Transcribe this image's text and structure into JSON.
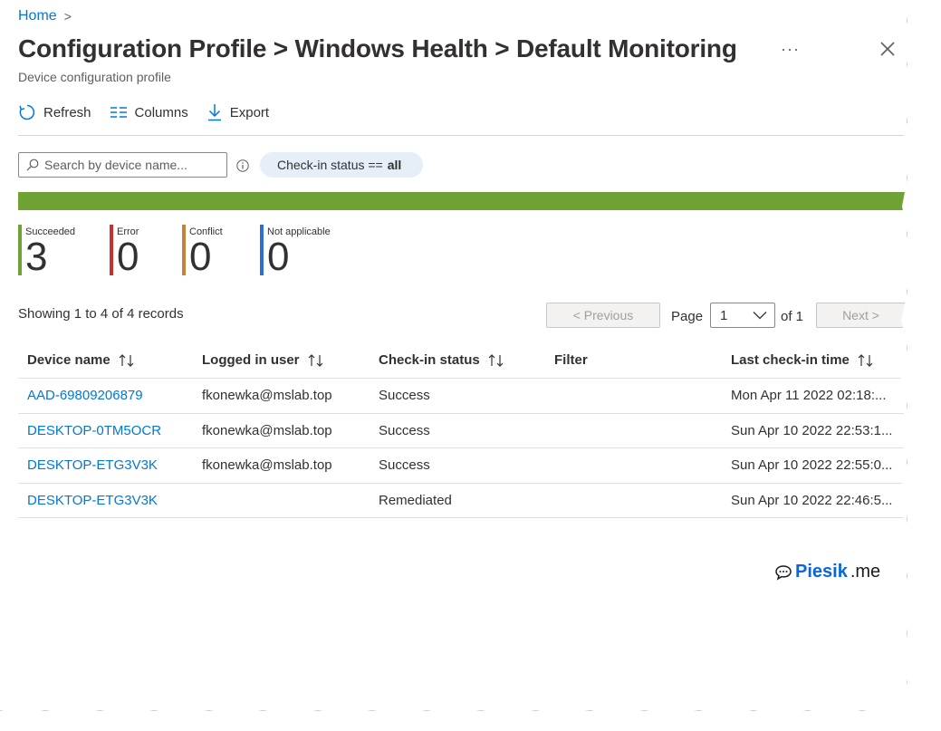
{
  "breadcrumb": {
    "home": "Home",
    "separator": ">"
  },
  "header": {
    "title": "Configuration Profile > Windows Health > Default Monitoring",
    "subtitle": "Device configuration profile",
    "more_glyph": "···",
    "close_icon": "close-icon"
  },
  "toolbar": {
    "refresh_label": "Refresh",
    "columns_label": "Columns",
    "export_label": "Export"
  },
  "filters": {
    "search_placeholder": "Search by device name...",
    "pill_prefix": "Check-in status ==",
    "pill_value": "all"
  },
  "progress": {
    "succeeded_fraction": 1.0,
    "color": "#6ea232"
  },
  "stats": [
    {
      "label": "Succeeded",
      "value": "3",
      "color": "#6ea232"
    },
    {
      "label": "Error",
      "value": "0",
      "color": "#c2342d"
    },
    {
      "label": "Conflict",
      "value": "0",
      "color": "#c8813a"
    },
    {
      "label": "Not applicable",
      "value": "0",
      "color": "#2f6fd1"
    }
  ],
  "pagination": {
    "showing": "Showing 1 to 4 of 4 records",
    "previous": "< Previous",
    "page_label": "Page",
    "page_value": "1",
    "of_label": "of 1",
    "next": "Next >"
  },
  "table": {
    "columns": [
      "Device name",
      "Logged in user",
      "Check-in status",
      "Filter",
      "Last check-in time"
    ],
    "sortable": [
      true,
      true,
      true,
      false,
      true
    ],
    "rows": [
      [
        "AAD-69809206879",
        "fkonewka@mslab.top",
        "Success",
        "",
        "Mon Apr 11 2022 02:18:..."
      ],
      [
        "DESKTOP-0TM5OCR",
        "fkonewka@mslab.top",
        "Success",
        "",
        "Sun Apr 10 2022 22:53:1..."
      ],
      [
        "DESKTOP-ETG3V3K",
        "fkonewka@mslab.top",
        "Success",
        "",
        "Sun Apr 10 2022 22:55:0..."
      ],
      [
        "DESKTOP-ETG3V3K",
        "",
        "Remediated",
        "",
        "Sun Apr 10 2022 22:46:5..."
      ]
    ]
  },
  "watermark": {
    "brand": "Piesik",
    "tld": ".me",
    "icon": "speech-bubble-icon"
  }
}
